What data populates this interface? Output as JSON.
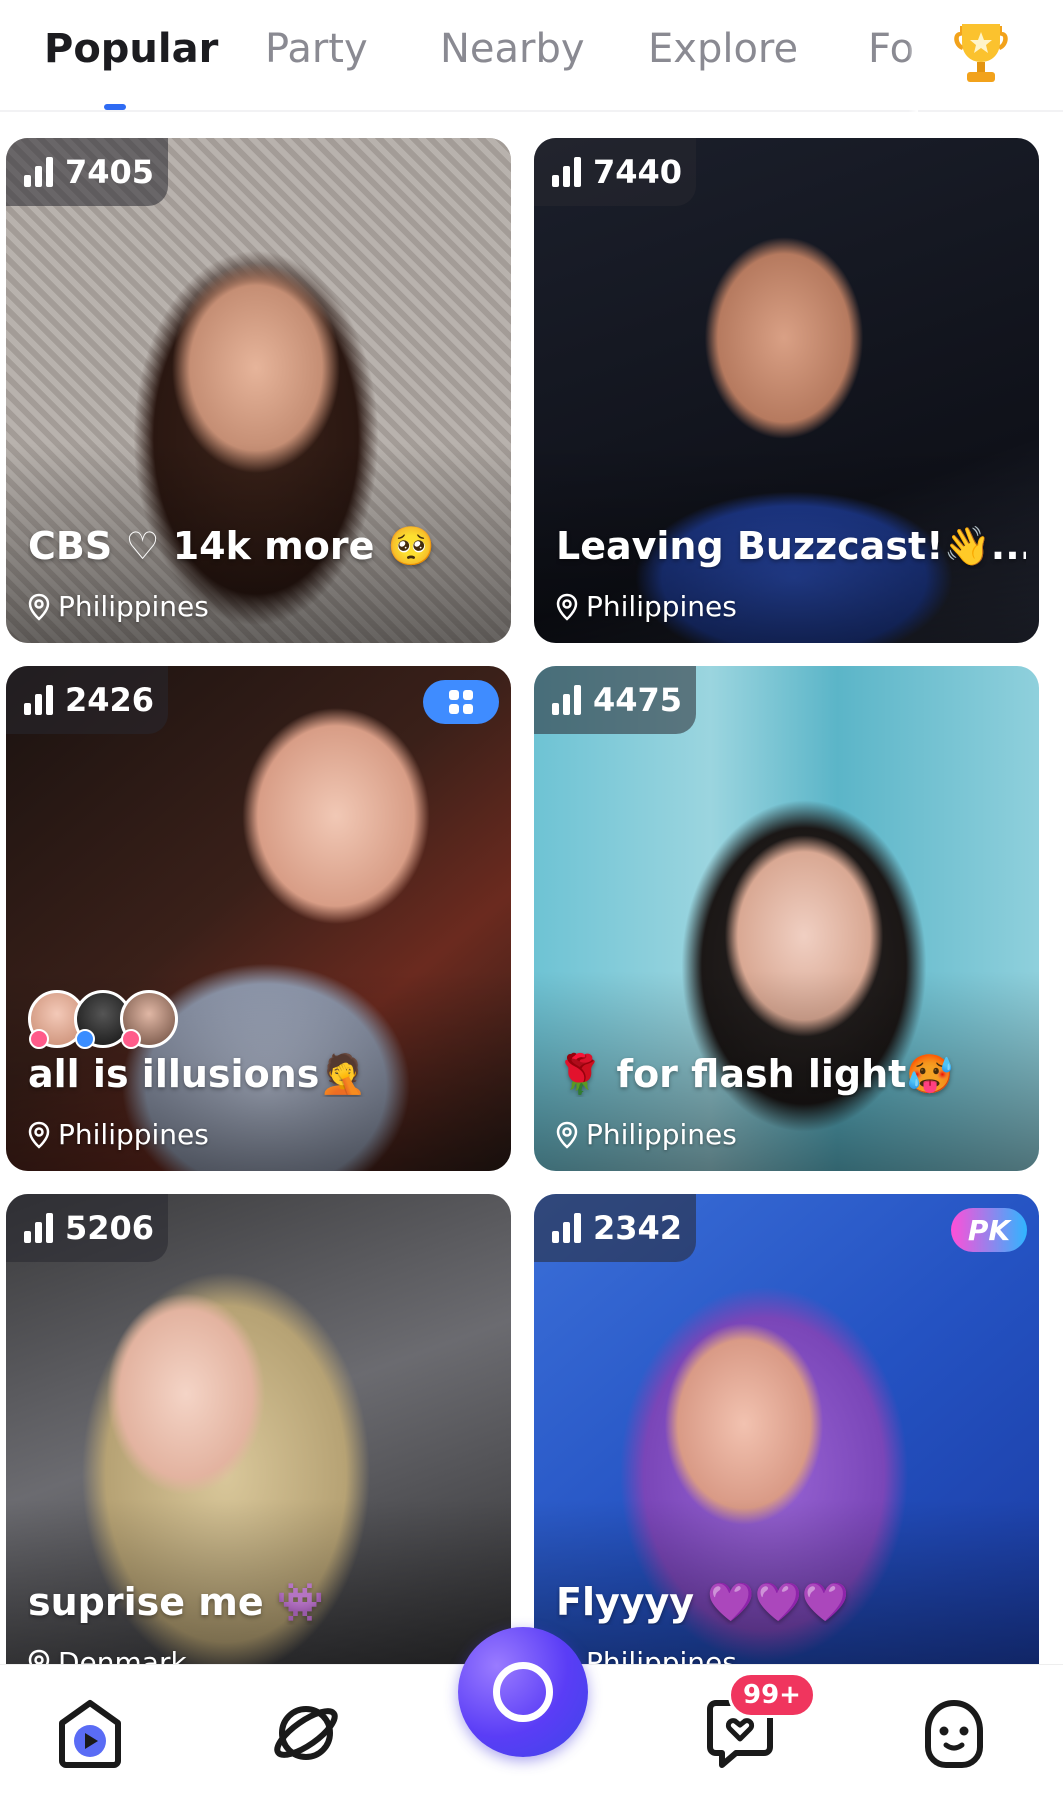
{
  "tabs": [
    "Popular",
    "Party",
    "Nearby",
    "Explore",
    "Fo"
  ],
  "cards": [
    {
      "viewers": "7405",
      "title": "CBS ♡      14k more 🥺",
      "location": "Philippines"
    },
    {
      "viewers": "7440",
      "title": "Leaving Buzzcast!👋...",
      "location": "Philippines"
    },
    {
      "viewers": "2426",
      "title": "all is illusions🤦",
      "location": "Philippines"
    },
    {
      "viewers": "4475",
      "title": "🌹 for flash light🥵",
      "location": "Philippines"
    },
    {
      "viewers": "5206",
      "title": "suprise me 👾",
      "location": "Denmark"
    },
    {
      "viewers": "2342",
      "title": "Flyyyy 💜💜💜",
      "location": "Philippines",
      "badge": "PK"
    }
  ],
  "nav": {
    "messages_badge": "99+"
  },
  "colors": {
    "accent": "#2f6bf3",
    "badge_red": "#f0355e",
    "center_button": "#5a3df6"
  }
}
